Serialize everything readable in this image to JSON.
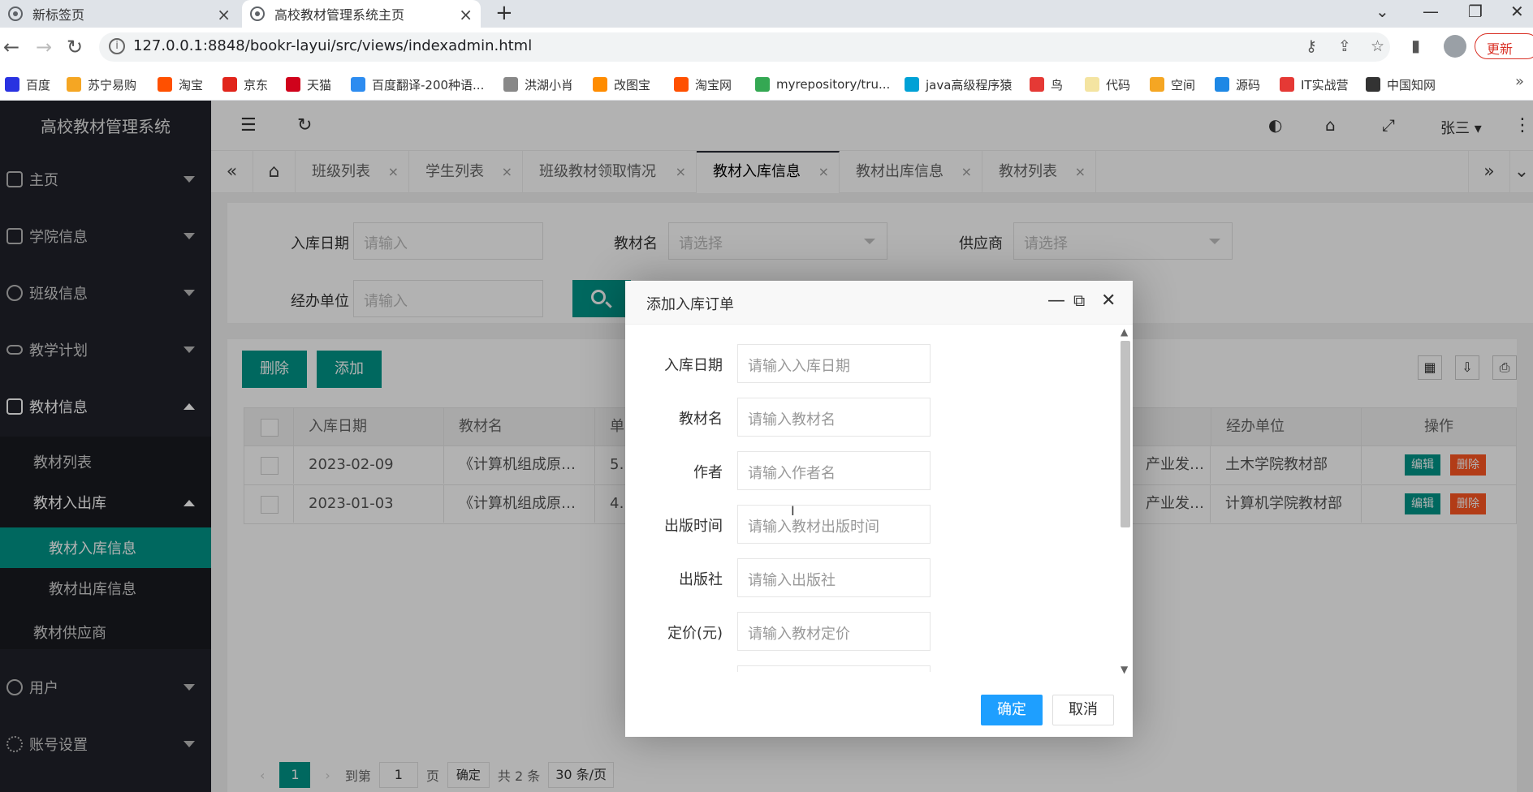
{
  "browser": {
    "tabs": [
      {
        "title": "新标签页",
        "close": "×"
      },
      {
        "title": "高校教材管理系统主页",
        "close": "×"
      }
    ],
    "new_tab": "+",
    "window_controls": {
      "dropdown": "⌄",
      "minimize": "—",
      "restore": "❐",
      "close": "✕"
    },
    "url": "127.0.0.1:8848/bookr-layui/src/views/indexadmin.html",
    "update_label": "更新",
    "bookmarks": [
      {
        "label": "百度",
        "color": "#2932e1"
      },
      {
        "label": "苏宁易购",
        "color": "#f5a623"
      },
      {
        "label": "淘宝",
        "color": "#ff5000"
      },
      {
        "label": "京东",
        "color": "#e1251b"
      },
      {
        "label": "天猫",
        "color": "#d0021b"
      },
      {
        "label": "百度翻译-200种语...",
        "color": "#2d8cf0"
      },
      {
        "label": "洪湖小肖",
        "color": "#888888"
      },
      {
        "label": "改图宝",
        "color": "#ff8c00"
      },
      {
        "label": "淘宝网",
        "color": "#ff5000"
      },
      {
        "label": "myrepository/tru...",
        "color": "#34a853"
      },
      {
        "label": "java高级程序猿",
        "color": "#00a1d6"
      },
      {
        "label": "鸟",
        "color": "#e53935"
      },
      {
        "label": "代码",
        "color": "#f4e4a1"
      },
      {
        "label": "空间",
        "color": "#f5a623"
      },
      {
        "label": "源码",
        "color": "#1e88e5"
      },
      {
        "label": "IT实战营",
        "color": "#e53935"
      },
      {
        "label": "中国知网",
        "color": "#333333"
      }
    ],
    "more": "»"
  },
  "app": {
    "brand": "高校教材管理系统",
    "menu": [
      {
        "label": "主页",
        "icon": "home-icon"
      },
      {
        "label": "学院信息",
        "icon": "apps-icon"
      },
      {
        "label": "班级信息",
        "icon": "compass-icon"
      },
      {
        "label": "教学计划",
        "icon": "infinity-icon"
      },
      {
        "label": "教材信息",
        "icon": "book-icon"
      },
      {
        "label": "用户",
        "icon": "user-icon"
      },
      {
        "label": "账号设置",
        "icon": "gear-icon"
      }
    ],
    "submenu": {
      "book_list": "教材列表",
      "book_io": "教材入出库",
      "book_in": "教材入库信息",
      "book_out": "教材出库信息",
      "supplier": "教材供应商"
    },
    "user": "张三 ▾"
  },
  "page_tabs": [
    {
      "label": "班级列表"
    },
    {
      "label": "学生列表"
    },
    {
      "label": "班级教材领取情况"
    },
    {
      "label": "教材入库信息"
    },
    {
      "label": "教材出库信息"
    },
    {
      "label": "教材列表"
    }
  ],
  "search": {
    "date_label": "入库日期",
    "date_placeholder": "请输入",
    "book_label": "教材名",
    "book_placeholder": "请选择",
    "supplier_label": "供应商",
    "supplier_placeholder": "请选择",
    "unit_label": "经办单位",
    "unit_placeholder": "请输入"
  },
  "table": {
    "delete_btn": "删除",
    "add_btn": "添加",
    "headers": {
      "date": "入库日期",
      "book": "教材名",
      "unit_price_partial": "单",
      "unit": "经办单位",
      "ops": "操作"
    },
    "rows": [
      {
        "date": "2023-02-09",
        "book": "《计算机组成原…",
        "price_partial": "54",
        "supplier_partial": "产业发…",
        "unit": "土木学院教材部"
      },
      {
        "date": "2023-01-03",
        "book": "《计算机组成原…",
        "price_partial": "43",
        "supplier_partial": "产业发…",
        "unit": "计算机学院教材部"
      }
    ],
    "edit_btn": "编辑",
    "row_delete_btn": "删除"
  },
  "pager": {
    "current": "1",
    "goto_label": "到第",
    "page_input": "1",
    "page_suffix": "页",
    "confirm": "确定",
    "total": "共 2 条",
    "per_page": "30 条/页"
  },
  "modal": {
    "title": "添加入库订单",
    "fields": [
      {
        "label": "入库日期",
        "placeholder": "请输入入库日期"
      },
      {
        "label": "教材名",
        "placeholder": "请输入教材名"
      },
      {
        "label": "作者",
        "placeholder": "请输入作者名"
      },
      {
        "label": "出版时间",
        "placeholder": "请输入教材出版时间"
      },
      {
        "label": "出版社",
        "placeholder": "请输入出版社"
      },
      {
        "label": "定价(元)",
        "placeholder": "请输入教材定价"
      }
    ],
    "ok": "确定",
    "cancel": "取消"
  }
}
